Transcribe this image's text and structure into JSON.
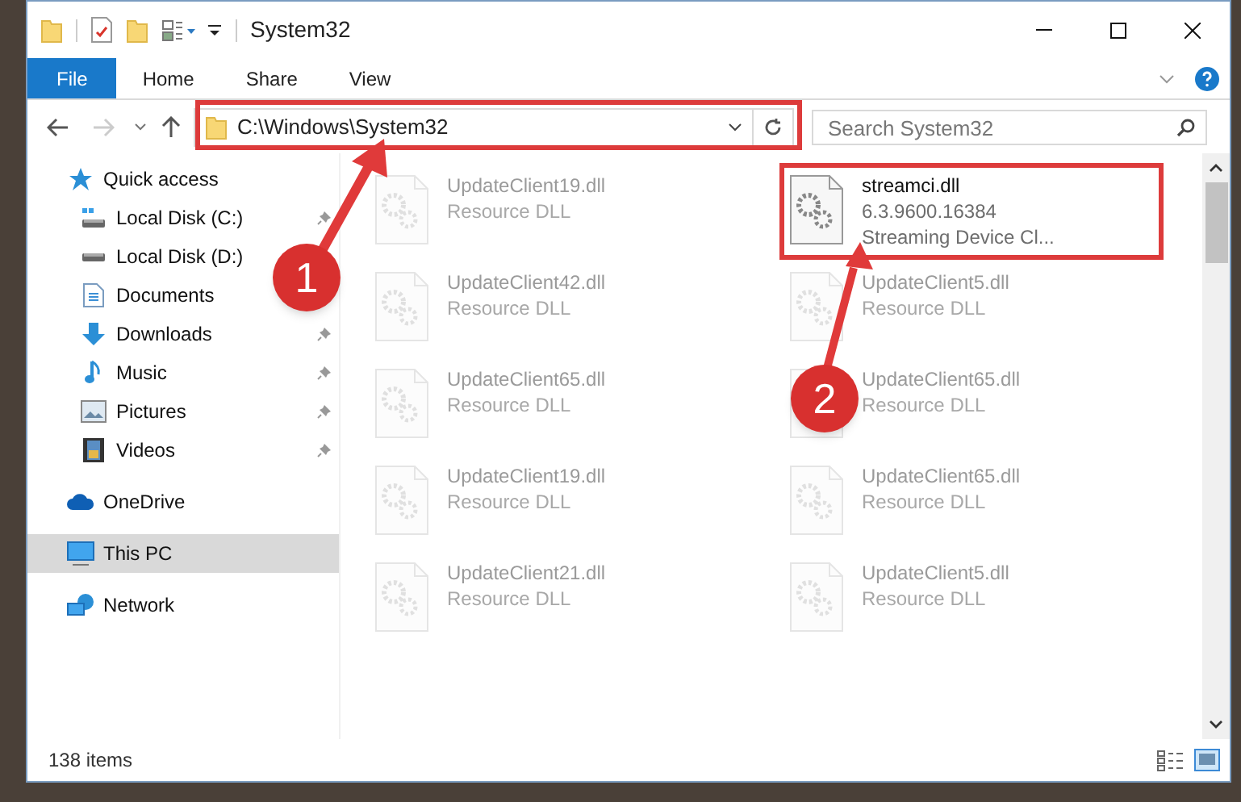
{
  "window": {
    "title": "System32"
  },
  "ribbon_tabs": [
    {
      "label": "File",
      "selected": true
    },
    {
      "label": "Home",
      "selected": false
    },
    {
      "label": "Share",
      "selected": false
    },
    {
      "label": "View",
      "selected": false
    }
  ],
  "address": {
    "value": "C:\\Windows\\System32"
  },
  "search": {
    "placeholder": "Search System32"
  },
  "sidebar": {
    "items": [
      {
        "label": "Quick access",
        "selected": false,
        "children": [
          {
            "label": "Local Disk (C:)",
            "pinned": true,
            "selected": false
          },
          {
            "label": "Local Disk (D:)",
            "selected": false
          },
          {
            "label": "Documents",
            "selected": false
          },
          {
            "label": "Downloads",
            "pinned": true,
            "selected": false
          },
          {
            "label": "Music",
            "pinned": true,
            "selected": false
          },
          {
            "label": "Pictures",
            "pinned": true,
            "selected": false
          },
          {
            "label": "Videos",
            "pinned": true,
            "selected": false
          }
        ]
      },
      {
        "label": "OneDrive",
        "selected": false
      },
      {
        "label": "This PC",
        "selected": true
      },
      {
        "label": "Network",
        "selected": false
      }
    ]
  },
  "files": [
    {
      "name": "UpdateClient19.dll",
      "details": [
        "Resource DLL"
      ],
      "blurred": true
    },
    {
      "name": "streamci.dll",
      "details": [
        "6.3.9600.16384",
        "Streaming Device Cl..."
      ],
      "blurred": false
    },
    {
      "name": "UpdateClient42.dll",
      "details": [
        "Resource DLL"
      ],
      "blurred": true
    },
    {
      "name": "UpdateClient5.dll",
      "details": [
        "Resource DLL"
      ],
      "blurred": true
    },
    {
      "name": "UpdateClient65.dll",
      "details": [
        "Resource DLL"
      ],
      "blurred": true
    },
    {
      "name": "UpdateClient65.dll",
      "details": [
        "Resource DLL"
      ],
      "blurred": true
    },
    {
      "name": "UpdateClient19.dll",
      "details": [
        "Resource DLL"
      ],
      "blurred": true
    },
    {
      "name": "UpdateClient65.dll",
      "details": [
        "Resource DLL"
      ],
      "blurred": true
    },
    {
      "name": "UpdateClient21.dll",
      "details": [
        "Resource DLL"
      ],
      "blurred": true
    },
    {
      "name": "UpdateClient5.dll",
      "details": [
        "Resource DLL"
      ],
      "blurred": true
    }
  ],
  "status_bar": {
    "item_count": "138 items"
  },
  "annotations": [
    {
      "kind": "callout",
      "label": "1"
    },
    {
      "kind": "callout",
      "label": "2"
    }
  ]
}
